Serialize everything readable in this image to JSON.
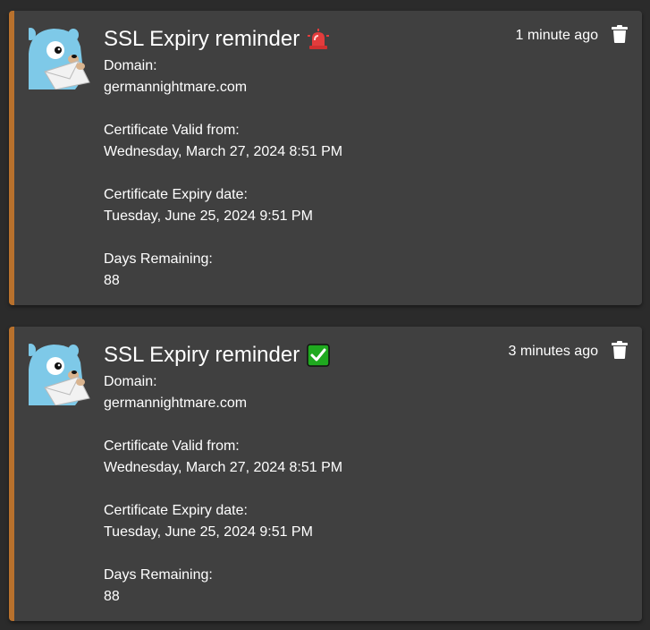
{
  "notifications": [
    {
      "title": "SSL Expiry reminder",
      "status_icon": "rotating-light-emoji",
      "time": "1 minute ago",
      "fields": [
        {
          "label": "Domain:",
          "value": "germannightmare.com"
        },
        {
          "label": "Certificate Valid from:",
          "value": "Wednesday, March 27, 2024 8:51 PM"
        },
        {
          "label": "Certificate Expiry date:",
          "value": "Tuesday, June 25, 2024 9:51 PM"
        },
        {
          "label": "Days Remaining:",
          "value": "88"
        }
      ]
    },
    {
      "title": "SSL Expiry reminder",
      "status_icon": "check-mark-button-emoji",
      "time": "3 minutes ago",
      "fields": [
        {
          "label": "Domain:",
          "value": "germannightmare.com"
        },
        {
          "label": "Certificate Valid from:",
          "value": "Wednesday, March 27, 2024 8:51 PM"
        },
        {
          "label": "Certificate Expiry date:",
          "value": "Tuesday, June 25, 2024 9:51 PM"
        },
        {
          "label": "Days Remaining:",
          "value": "88"
        }
      ]
    }
  ],
  "colors": {
    "page_background": "#2b2b2b",
    "card_background": "#404040",
    "accent_border": "#b8712d",
    "text": "#ffffff"
  },
  "icons": {
    "avatar": "gopher-mail-avatar-icon",
    "delete": "trash-icon"
  }
}
